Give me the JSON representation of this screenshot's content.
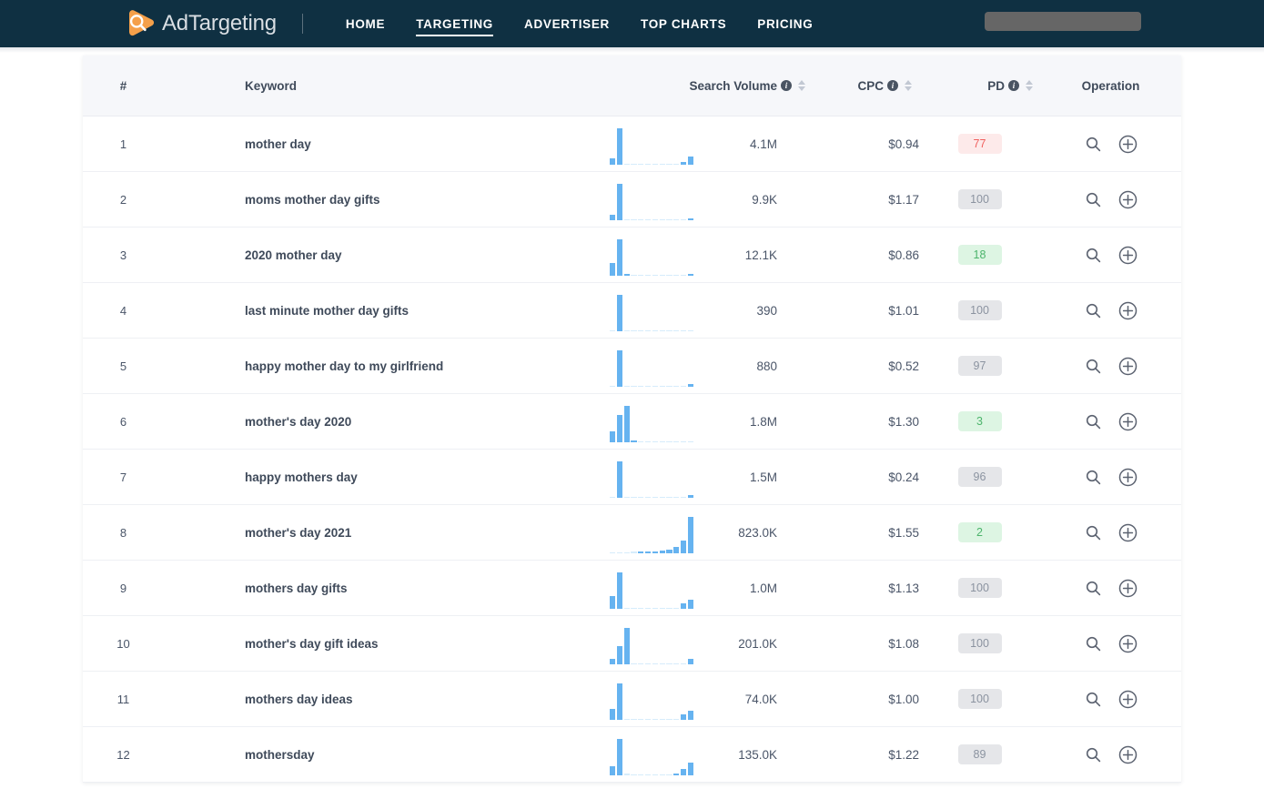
{
  "header": {
    "brand_name": "AdTargeting",
    "logo_icon": "magnifier-logo-icon",
    "nav_items": [
      {
        "label": "HOME",
        "active": false
      },
      {
        "label": "TARGETING",
        "active": true
      },
      {
        "label": "ADVERTISER",
        "active": false
      },
      {
        "label": "TOP CHARTS",
        "active": false
      },
      {
        "label": "PRICING",
        "active": false
      }
    ],
    "search_value": "",
    "search_placeholder": ""
  },
  "table": {
    "columns": {
      "rank": "#",
      "keyword": "Keyword",
      "search_volume": "Search Volume",
      "cpc": "CPC",
      "pd": "PD",
      "operation": "Operation"
    },
    "info_glyph": "i",
    "icons": {
      "search": "search-icon",
      "add": "plus-circle-icon",
      "sort": "sort-arrows-icon",
      "info": "info-icon"
    },
    "rows": [
      {
        "rank": "1",
        "keyword": "mother day",
        "volume": "4.1M",
        "cpc": "$0.94",
        "pd": "77",
        "pd_style": "red",
        "spark": [
          18,
          100,
          3,
          2,
          2,
          2,
          2,
          2,
          2,
          3,
          8,
          22
        ]
      },
      {
        "rank": "2",
        "keyword": "moms mother day gifts",
        "volume": "9.9K",
        "cpc": "$1.17",
        "pd": "100",
        "pd_style": "gray",
        "spark": [
          14,
          100,
          2,
          2,
          2,
          2,
          2,
          2,
          2,
          2,
          3,
          5
        ]
      },
      {
        "rank": "3",
        "keyword": "2020 mother day",
        "volume": "12.1K",
        "cpc": "$0.86",
        "pd": "18",
        "pd_style": "green",
        "spark": [
          36,
          100,
          6,
          2,
          2,
          2,
          2,
          2,
          2,
          2,
          3,
          6
        ]
      },
      {
        "rank": "4",
        "keyword": "last minute mother day gifts",
        "volume": "390",
        "cpc": "$1.01",
        "pd": "100",
        "pd_style": "gray",
        "spark": [
          2,
          100,
          2,
          2,
          2,
          2,
          2,
          2,
          2,
          2,
          2,
          2
        ]
      },
      {
        "rank": "5",
        "keyword": "happy mother day to my girlfriend",
        "volume": "880",
        "cpc": "$0.52",
        "pd": "97",
        "pd_style": "gray",
        "spark": [
          2,
          100,
          2,
          2,
          2,
          2,
          2,
          2,
          2,
          2,
          2,
          7
        ]
      },
      {
        "rank": "6",
        "keyword": "mother's day 2020",
        "volume": "1.8M",
        "cpc": "$1.30",
        "pd": "3",
        "pd_style": "green",
        "spark": [
          30,
          74,
          100,
          6,
          3,
          3,
          3,
          3,
          3,
          3,
          3,
          3
        ]
      },
      {
        "rank": "7",
        "keyword": "happy mothers day",
        "volume": "1.5M",
        "cpc": "$0.24",
        "pd": "96",
        "pd_style": "gray",
        "spark": [
          3,
          100,
          3,
          2,
          2,
          2,
          2,
          2,
          2,
          2,
          3,
          7
        ]
      },
      {
        "rank": "8",
        "keyword": "mother's day 2021",
        "volume": "823.0K",
        "cpc": "$1.55",
        "pd": "2",
        "pd_style": "green",
        "spark": [
          2,
          2,
          3,
          4,
          5,
          5,
          6,
          7,
          9,
          18,
          36,
          100
        ]
      },
      {
        "rank": "9",
        "keyword": "mothers day gifts",
        "volume": "1.0M",
        "cpc": "$1.13",
        "pd": "100",
        "pd_style": "gray",
        "spark": [
          36,
          100,
          3,
          2,
          2,
          2,
          2,
          2,
          2,
          3,
          14,
          24
        ]
      },
      {
        "rank": "10",
        "keyword": "mother's day gift ideas",
        "volume": "201.0K",
        "cpc": "$1.08",
        "pd": "100",
        "pd_style": "gray",
        "spark": [
          14,
          50,
          100,
          3,
          2,
          2,
          2,
          2,
          2,
          2,
          2,
          14
        ]
      },
      {
        "rank": "11",
        "keyword": "mothers day ideas",
        "volume": "74.0K",
        "cpc": "$1.00",
        "pd": "100",
        "pd_style": "gray",
        "spark": [
          30,
          100,
          3,
          2,
          2,
          2,
          2,
          2,
          2,
          3,
          14,
          26
        ]
      },
      {
        "rank": "12",
        "keyword": "mothersday",
        "volume": "135.0K",
        "cpc": "$1.22",
        "pd": "89",
        "pd_style": "gray",
        "spark": [
          24,
          100,
          4,
          3,
          3,
          3,
          3,
          3,
          3,
          6,
          18,
          34
        ]
      }
    ]
  },
  "colors": {
    "nav_background": "#0f3042",
    "brand_orange": "#f5a04a",
    "spark_bar": "#66b3f0",
    "badge_red": "#f0615f",
    "badge_green": "#4cb46b",
    "badge_gray": "#8b93a0"
  }
}
